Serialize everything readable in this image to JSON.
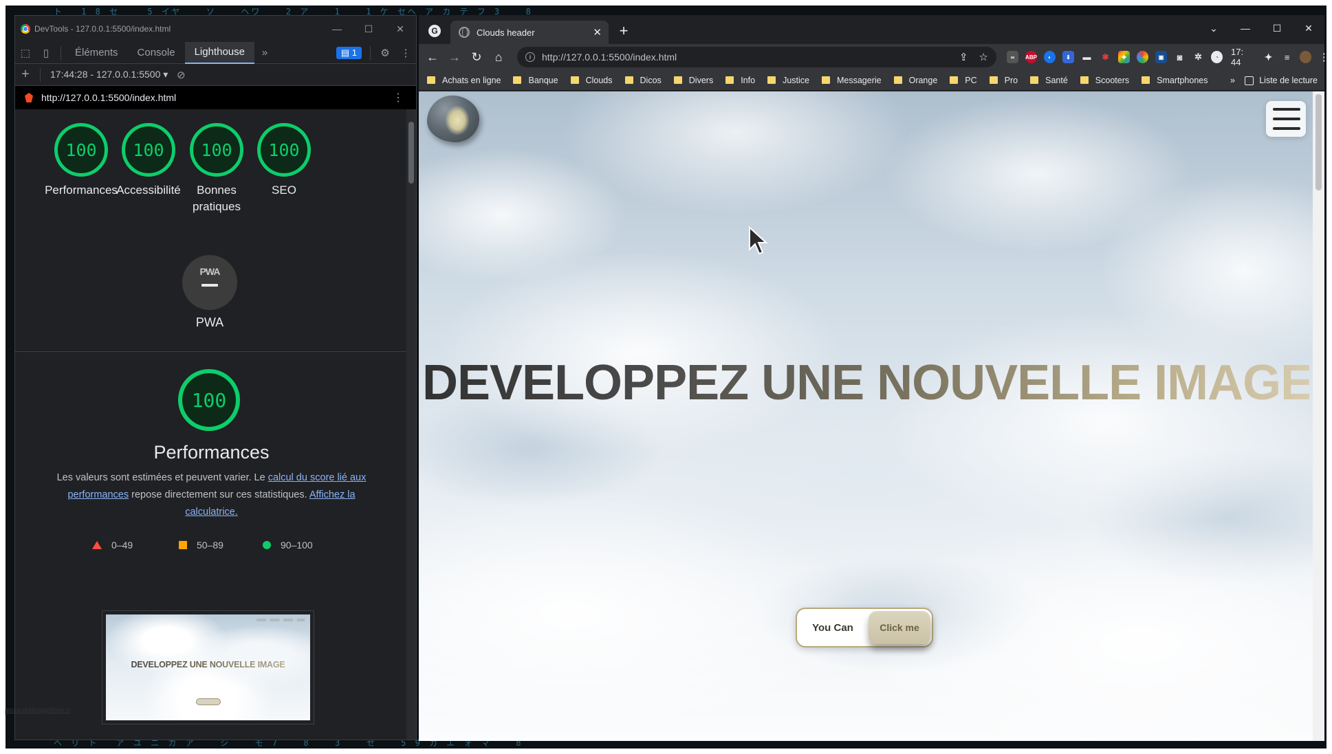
{
  "devtools": {
    "window_title": "DevTools - 127.0.0.1:5500/index.html",
    "tabs": [
      "Éléments",
      "Console",
      "Lighthouse"
    ],
    "active_tab": "Lighthouse",
    "more_tabs_icon": "chevron-double-right-icon",
    "issues_count": "1",
    "report_selector": "17:44:28 - 127.0.0.1:5500",
    "report_url": "http://127.0.0.1:5500/index.html",
    "scores": [
      {
        "label": "Performances",
        "value": "100"
      },
      {
        "label": "Accessibilité",
        "value": "100"
      },
      {
        "label": "Bonnes pratiques",
        "value": "100"
      },
      {
        "label": "SEO",
        "value": "100"
      }
    ],
    "pwa": {
      "badge": "PWA",
      "label": "PWA"
    },
    "performance_section": {
      "score": "100",
      "title": "Performances",
      "desc_part1": "Les valeurs sont estimées et peuvent varier. Le ",
      "desc_link1": "calcul du score lié aux performances",
      "desc_part2": " repose directement sur ces statistiques. ",
      "desc_link2": "Affichez la calculatrice."
    },
    "legend": [
      {
        "range": "0–49",
        "color": "#ff4e42",
        "shape": "triangle"
      },
      {
        "range": "50–89",
        "color": "#ffa400",
        "shape": "square"
      },
      {
        "range": "90–100",
        "color": "#0cce6b",
        "shape": "circle"
      }
    ],
    "thumbnail_title": "DEVELOPPEZ UNE NOUVELLE IMAGE"
  },
  "browser": {
    "tab_title": "Clouds header",
    "url_scheme_host": "http://127.0.0.1",
    "url_rest": ":5500/index.html",
    "clock": "17: 44",
    "bookmarks": [
      "Achats en ligne",
      "Banque",
      "Clouds",
      "Dicos",
      "Divers",
      "Info",
      "Justice",
      "Messagerie",
      "Orange",
      "PC",
      "Pro",
      "Santé",
      "Scooters",
      "Smartphones"
    ],
    "reading_list": "Liste de lecture",
    "accent_colors": {
      "abp": "#c70d2c",
      "ext_blue": "#1a73e8"
    }
  },
  "page": {
    "hero_title": "DEVELOPPEZ UNE NOUVELLE IMAGE",
    "button_left": "You Can",
    "button_right": "Click me",
    "footer_email": "alexandrebraga@free.fr"
  }
}
